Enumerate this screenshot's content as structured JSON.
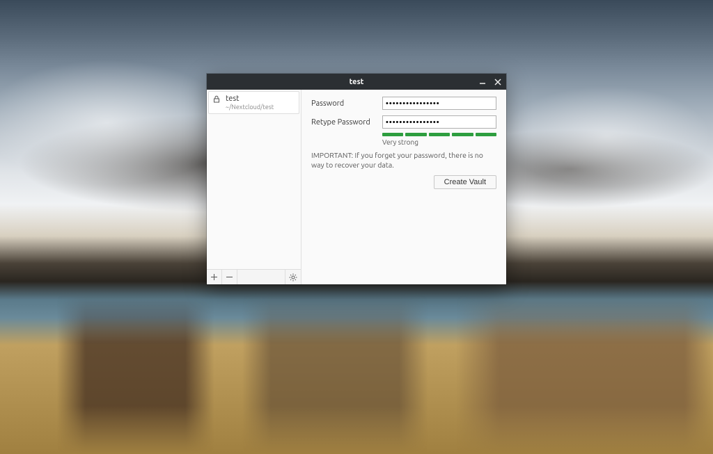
{
  "window": {
    "title": "test"
  },
  "sidebar": {
    "vaults": [
      {
        "name": "test",
        "path": "~/Nextcloud/test"
      }
    ],
    "toolbar": {
      "add_tooltip": "Add Vault",
      "remove_tooltip": "Remove Vault",
      "settings_tooltip": "Preferences"
    }
  },
  "form": {
    "password_label": "Password",
    "retype_label": "Retype Password",
    "password_value": "••••••••••••••••",
    "retype_value": "••••••••••••••••",
    "strength_label": "Very strong",
    "strength_segments": 5,
    "strength_color": "#2e9e3f",
    "warning": "IMPORTANT: If you forget your password, there is no way to recover your data.",
    "submit_label": "Create Vault"
  }
}
